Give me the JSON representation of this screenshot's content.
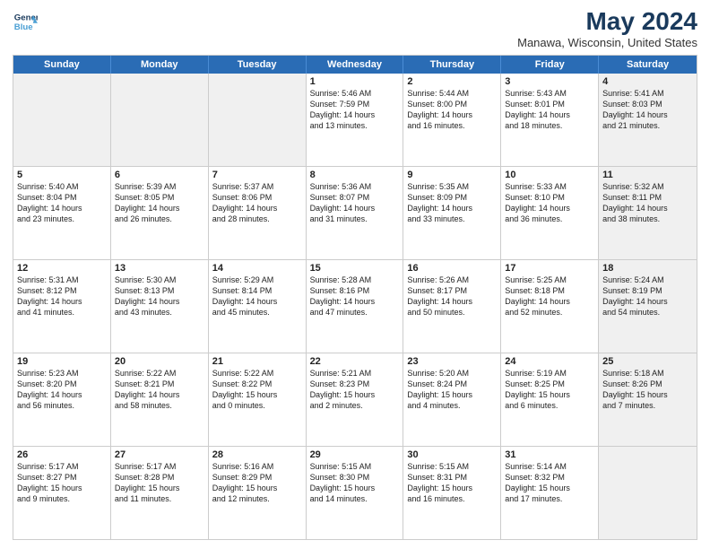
{
  "logo": {
    "line1": "General",
    "line2": "Blue"
  },
  "title": "May 2024",
  "subtitle": "Manawa, Wisconsin, United States",
  "days_of_week": [
    "Sunday",
    "Monday",
    "Tuesday",
    "Wednesday",
    "Thursday",
    "Friday",
    "Saturday"
  ],
  "weeks": [
    [
      {
        "day": "",
        "text": "",
        "shaded": true
      },
      {
        "day": "",
        "text": "",
        "shaded": true
      },
      {
        "day": "",
        "text": "",
        "shaded": true
      },
      {
        "day": "1",
        "text": "Sunrise: 5:46 AM\nSunset: 7:59 PM\nDaylight: 14 hours\nand 13 minutes."
      },
      {
        "day": "2",
        "text": "Sunrise: 5:44 AM\nSunset: 8:00 PM\nDaylight: 14 hours\nand 16 minutes."
      },
      {
        "day": "3",
        "text": "Sunrise: 5:43 AM\nSunset: 8:01 PM\nDaylight: 14 hours\nand 18 minutes."
      },
      {
        "day": "4",
        "text": "Sunrise: 5:41 AM\nSunset: 8:03 PM\nDaylight: 14 hours\nand 21 minutes.",
        "shaded": true
      }
    ],
    [
      {
        "day": "5",
        "text": "Sunrise: 5:40 AM\nSunset: 8:04 PM\nDaylight: 14 hours\nand 23 minutes."
      },
      {
        "day": "6",
        "text": "Sunrise: 5:39 AM\nSunset: 8:05 PM\nDaylight: 14 hours\nand 26 minutes."
      },
      {
        "day": "7",
        "text": "Sunrise: 5:37 AM\nSunset: 8:06 PM\nDaylight: 14 hours\nand 28 minutes."
      },
      {
        "day": "8",
        "text": "Sunrise: 5:36 AM\nSunset: 8:07 PM\nDaylight: 14 hours\nand 31 minutes."
      },
      {
        "day": "9",
        "text": "Sunrise: 5:35 AM\nSunset: 8:09 PM\nDaylight: 14 hours\nand 33 minutes."
      },
      {
        "day": "10",
        "text": "Sunrise: 5:33 AM\nSunset: 8:10 PM\nDaylight: 14 hours\nand 36 minutes."
      },
      {
        "day": "11",
        "text": "Sunrise: 5:32 AM\nSunset: 8:11 PM\nDaylight: 14 hours\nand 38 minutes.",
        "shaded": true
      }
    ],
    [
      {
        "day": "12",
        "text": "Sunrise: 5:31 AM\nSunset: 8:12 PM\nDaylight: 14 hours\nand 41 minutes."
      },
      {
        "day": "13",
        "text": "Sunrise: 5:30 AM\nSunset: 8:13 PM\nDaylight: 14 hours\nand 43 minutes."
      },
      {
        "day": "14",
        "text": "Sunrise: 5:29 AM\nSunset: 8:14 PM\nDaylight: 14 hours\nand 45 minutes."
      },
      {
        "day": "15",
        "text": "Sunrise: 5:28 AM\nSunset: 8:16 PM\nDaylight: 14 hours\nand 47 minutes."
      },
      {
        "day": "16",
        "text": "Sunrise: 5:26 AM\nSunset: 8:17 PM\nDaylight: 14 hours\nand 50 minutes."
      },
      {
        "day": "17",
        "text": "Sunrise: 5:25 AM\nSunset: 8:18 PM\nDaylight: 14 hours\nand 52 minutes."
      },
      {
        "day": "18",
        "text": "Sunrise: 5:24 AM\nSunset: 8:19 PM\nDaylight: 14 hours\nand 54 minutes.",
        "shaded": true
      }
    ],
    [
      {
        "day": "19",
        "text": "Sunrise: 5:23 AM\nSunset: 8:20 PM\nDaylight: 14 hours\nand 56 minutes."
      },
      {
        "day": "20",
        "text": "Sunrise: 5:22 AM\nSunset: 8:21 PM\nDaylight: 14 hours\nand 58 minutes."
      },
      {
        "day": "21",
        "text": "Sunrise: 5:22 AM\nSunset: 8:22 PM\nDaylight: 15 hours\nand 0 minutes."
      },
      {
        "day": "22",
        "text": "Sunrise: 5:21 AM\nSunset: 8:23 PM\nDaylight: 15 hours\nand 2 minutes."
      },
      {
        "day": "23",
        "text": "Sunrise: 5:20 AM\nSunset: 8:24 PM\nDaylight: 15 hours\nand 4 minutes."
      },
      {
        "day": "24",
        "text": "Sunrise: 5:19 AM\nSunset: 8:25 PM\nDaylight: 15 hours\nand 6 minutes."
      },
      {
        "day": "25",
        "text": "Sunrise: 5:18 AM\nSunset: 8:26 PM\nDaylight: 15 hours\nand 7 minutes.",
        "shaded": true
      }
    ],
    [
      {
        "day": "26",
        "text": "Sunrise: 5:17 AM\nSunset: 8:27 PM\nDaylight: 15 hours\nand 9 minutes."
      },
      {
        "day": "27",
        "text": "Sunrise: 5:17 AM\nSunset: 8:28 PM\nDaylight: 15 hours\nand 11 minutes."
      },
      {
        "day": "28",
        "text": "Sunrise: 5:16 AM\nSunset: 8:29 PM\nDaylight: 15 hours\nand 12 minutes."
      },
      {
        "day": "29",
        "text": "Sunrise: 5:15 AM\nSunset: 8:30 PM\nDaylight: 15 hours\nand 14 minutes."
      },
      {
        "day": "30",
        "text": "Sunrise: 5:15 AM\nSunset: 8:31 PM\nDaylight: 15 hours\nand 16 minutes."
      },
      {
        "day": "31",
        "text": "Sunrise: 5:14 AM\nSunset: 8:32 PM\nDaylight: 15 hours\nand 17 minutes."
      },
      {
        "day": "",
        "text": "",
        "shaded": true
      }
    ]
  ]
}
